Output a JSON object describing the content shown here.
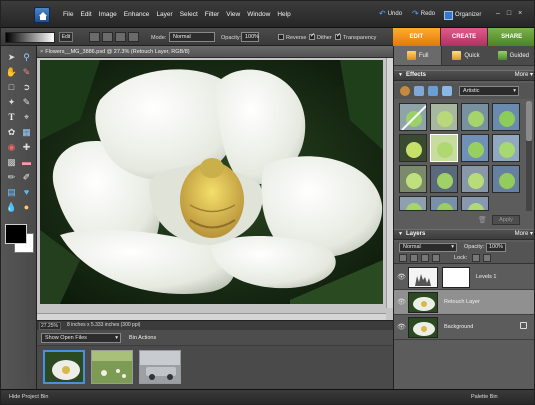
{
  "menubar": {
    "items": [
      "File",
      "Edit",
      "Image",
      "Enhance",
      "Layer",
      "Select",
      "Filter",
      "View",
      "Window",
      "Help"
    ],
    "undo_label": "Undo",
    "redo_label": "Redo",
    "organizer_label": "Organizer",
    "window_controls": [
      "–",
      "□",
      "×"
    ]
  },
  "options_bar": {
    "edit_label": "Edit",
    "mode_label": "Mode:",
    "mode_value": "Normal",
    "opacity_label": "Opacity:",
    "opacity_value": "100%",
    "reverse_label": "Reverse",
    "dither_label": "Dither",
    "transparency_label": "Transparency",
    "reverse_checked": false,
    "dither_checked": true,
    "transparency_checked": true
  },
  "mode_tabs": [
    "EDIT",
    "CREATE",
    "SHARE"
  ],
  "panel_tabs": [
    "Full",
    "Quick",
    "Guided"
  ],
  "document": {
    "title": "Flowers__MG_3886.psd @ 27.3% (Retouch Layer, RGB/8)",
    "zoom": "27.25%",
    "info": "8 inches x 5.333 inches (300 ppi)"
  },
  "bin": {
    "show_label": "Show Open Files",
    "actions_label": "Bin Actions",
    "hide_label": "Hide Project Bin",
    "palette_label": "Palette Bin"
  },
  "effects": {
    "title": "Effects",
    "category": "Artistic",
    "apply_label": "Apply",
    "menu_label": "More ▾"
  },
  "layers": {
    "title": "Layers",
    "menu_label": "More ▾",
    "blend_mode": "Normal",
    "opacity_label": "Opacity:",
    "opacity_value": "100%",
    "lock_label": "Lock:",
    "items": [
      {
        "name": "Levels 1",
        "selected": false
      },
      {
        "name": "Retouch Layer",
        "selected": true
      },
      {
        "name": "Background",
        "selected": false
      }
    ]
  },
  "icons": [
    "home-icon",
    "undo-icon",
    "redo-icon",
    "organizer-icon",
    "eye-icon",
    "lock-icon",
    "trash-icon",
    "fx-icon"
  ],
  "colors": {
    "edit_tab": "#f0901a",
    "create_tab": "#cc4476",
    "share_tab": "#62a03a",
    "selection_blue": "#4a90e2",
    "foreground": "#000000",
    "background": "#ffffff"
  }
}
